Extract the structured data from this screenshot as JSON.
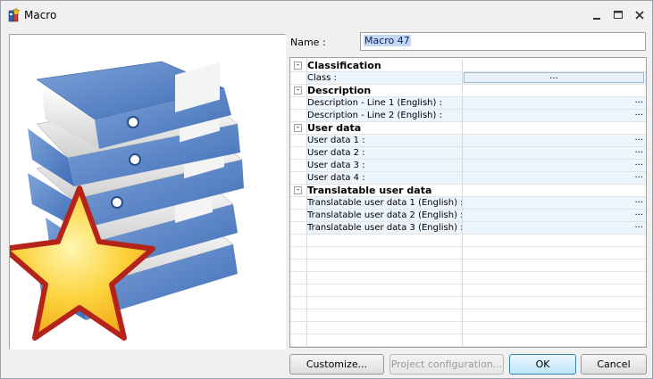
{
  "window": {
    "title": "Macro"
  },
  "icons": {
    "app": "macro-window-icon",
    "minimize": "minimize-icon",
    "maximize": "maximize-icon",
    "close": "close-icon"
  },
  "form": {
    "name_label": "Name :",
    "name_value": "Macro 47"
  },
  "grid": {
    "rows": [
      {
        "type": "category",
        "label": "Classification",
        "expander": "-"
      },
      {
        "type": "property",
        "label": "Class :",
        "value_button": "..."
      },
      {
        "type": "category",
        "label": "Description",
        "expander": "-"
      },
      {
        "type": "property",
        "label": "Description - Line 1 (English) :",
        "ellipsis": "..."
      },
      {
        "type": "property",
        "label": "Description - Line 2 (English) :",
        "ellipsis": "..."
      },
      {
        "type": "category",
        "label": "User data",
        "expander": "-"
      },
      {
        "type": "property",
        "label": "User data 1 :",
        "ellipsis": "..."
      },
      {
        "type": "property",
        "label": "User data 2 :",
        "ellipsis": "..."
      },
      {
        "type": "property",
        "label": "User data 3 :",
        "ellipsis": "..."
      },
      {
        "type": "property",
        "label": "User data 4 :",
        "ellipsis": "..."
      },
      {
        "type": "category",
        "label": "Translatable user data",
        "expander": "-"
      },
      {
        "type": "property",
        "label": "Translatable user data 1 (English) :",
        "ellipsis": "..."
      },
      {
        "type": "property",
        "label": "Translatable user data 2 (English) :",
        "ellipsis": "..."
      },
      {
        "type": "property",
        "label": "Translatable user data 3 (English) :",
        "ellipsis": "..."
      }
    ],
    "empty_rows": 9
  },
  "buttons": {
    "customize": "Customize...",
    "project_configuration": "Project configuration...",
    "ok": "OK",
    "cancel": "Cancel"
  }
}
